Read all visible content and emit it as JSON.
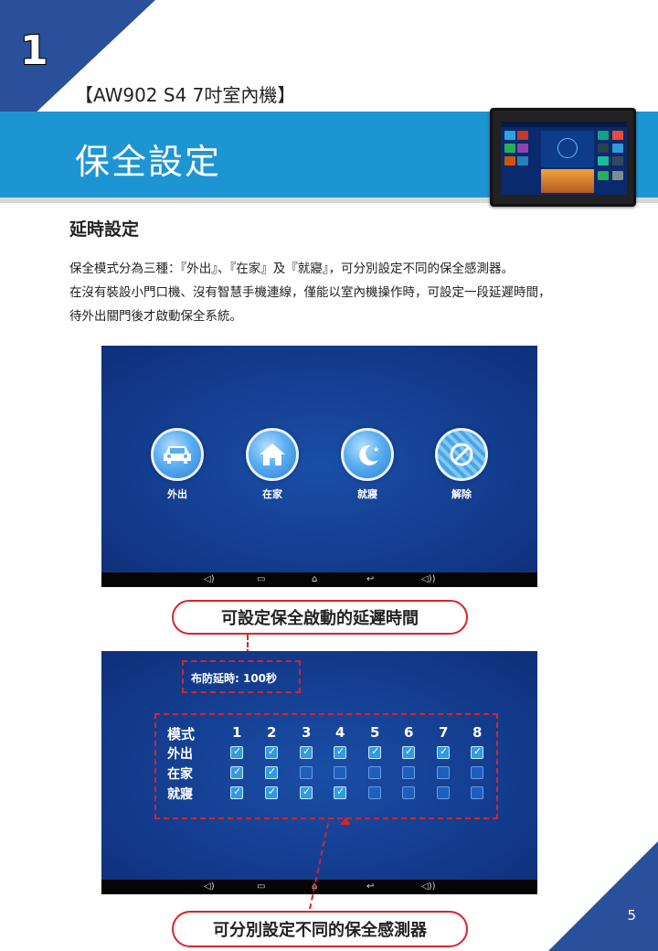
{
  "chapter_number": "1",
  "product_subtitle": "【AW902 S4 7吋室內機】",
  "banner_title": "保全設定",
  "section_heading": "延時設定",
  "paragraph_lines": [
    "保全模式分為三種：『外出』、『在家』及『就寢』，可分別設定不同的保全感測器。",
    "在沒有裝設小門口機、沒有智慧手機連線，僅能以室內機操作時，可設定一段延遲時間，",
    "待外出關門後才啟動保全系統。"
  ],
  "screenshot1": {
    "modes": [
      {
        "label": "外出",
        "icon": "car-icon"
      },
      {
        "label": "在家",
        "icon": "house-icon"
      },
      {
        "label": "就寢",
        "icon": "moon-icon"
      },
      {
        "label": "解除",
        "icon": "prohibit-icon"
      }
    ]
  },
  "callout1": "可設定保全啟動的延遲時間",
  "screenshot2": {
    "delay_label": "布防延時:  100秒",
    "header": "模式",
    "zones": [
      "1",
      "2",
      "3",
      "4",
      "5",
      "6",
      "7",
      "8"
    ],
    "rows": [
      {
        "label": "外出",
        "checks": [
          true,
          true,
          true,
          true,
          true,
          true,
          true,
          true
        ]
      },
      {
        "label": "在家",
        "checks": [
          true,
          true,
          false,
          false,
          false,
          false,
          false,
          false
        ]
      },
      {
        "label": "就寢",
        "checks": [
          true,
          true,
          true,
          true,
          false,
          false,
          false,
          false
        ]
      }
    ]
  },
  "callout2": "可分別設定不同的保全感測器",
  "page_number": "5",
  "colors": {
    "accent_blue": "#1e95d3",
    "dark_blue": "#2a4f9b",
    "callout_red": "#d9242a"
  }
}
